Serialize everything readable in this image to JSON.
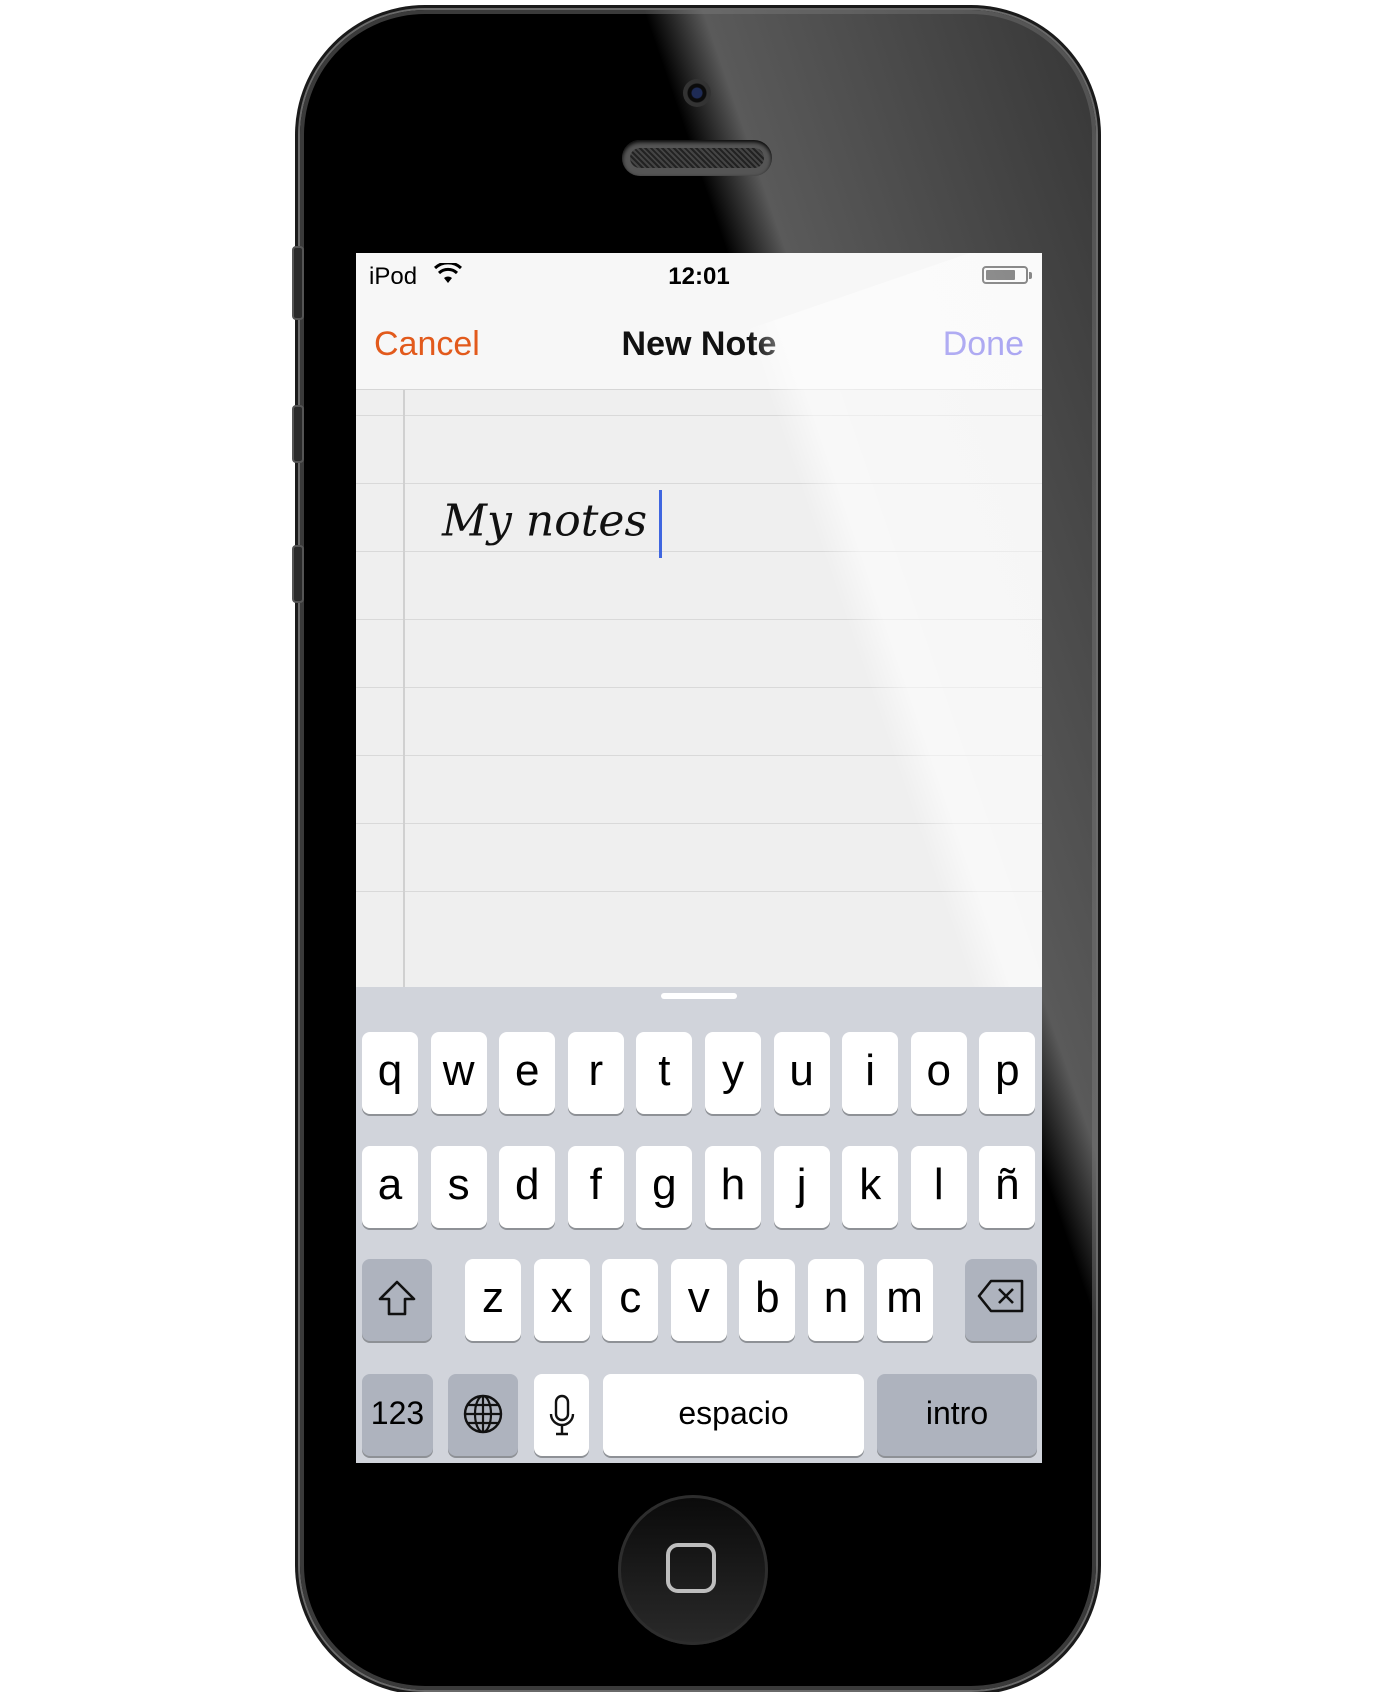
{
  "status_bar": {
    "carrier": "iPod",
    "time": "12:01",
    "battery_level": 0.75,
    "wifi_icon": "wifi-icon"
  },
  "nav": {
    "cancel_label": "Cancel",
    "title": "New Note",
    "done_label": "Done"
  },
  "note": {
    "text": "My notes"
  },
  "keyboard": {
    "row1": [
      "q",
      "w",
      "e",
      "r",
      "t",
      "y",
      "u",
      "i",
      "o",
      "p"
    ],
    "row2": [
      "a",
      "s",
      "d",
      "f",
      "g",
      "h",
      "j",
      "k",
      "l",
      "ñ"
    ],
    "row3": [
      "z",
      "x",
      "c",
      "v",
      "b",
      "n",
      "m"
    ],
    "numbers_label": "123",
    "space_label": "espacio",
    "return_label": "intro",
    "icons": {
      "shift": "shift-icon",
      "delete": "delete-icon",
      "globe": "globe-icon",
      "mic": "microphone-icon"
    }
  },
  "colors": {
    "cancel": "#e25a1c",
    "done": "#6b63e8",
    "caret": "#3f66e0"
  }
}
